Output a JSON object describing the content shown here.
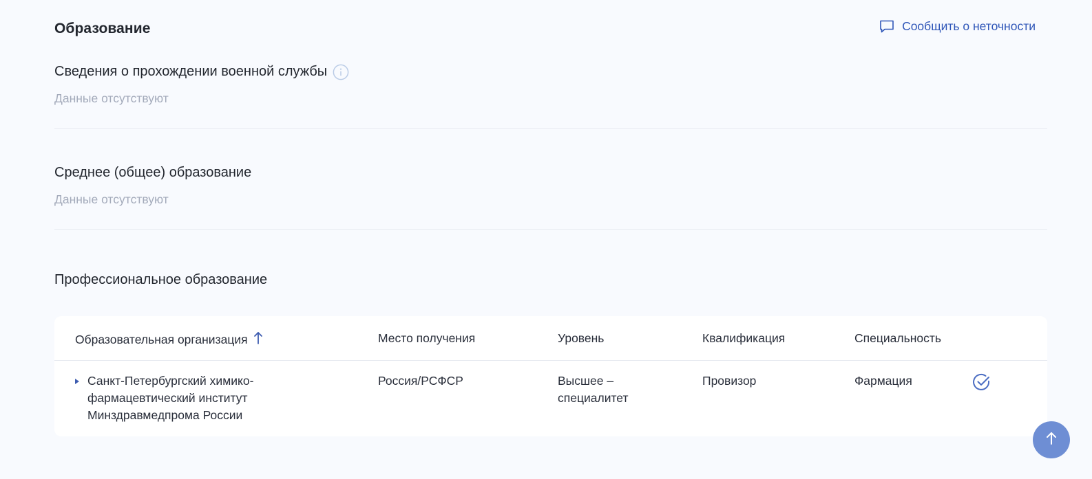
{
  "header": {
    "title": "Образование",
    "report_link": "Сообщить о неточности",
    "report_icon": "chat-bubble-icon"
  },
  "military": {
    "title": "Сведения о прохождении военной службы",
    "info_icon": "info-icon",
    "empty": "Данные отсутствуют"
  },
  "secondary": {
    "title": "Среднее (общее) образование",
    "empty": "Данные отсутствуют"
  },
  "professional": {
    "title": "Профессиональное образование",
    "columns": [
      "Образовательная организация",
      "Место получения",
      "Уровень",
      "Квалификация",
      "Специальность"
    ],
    "sort_icon": "arrow-up-icon",
    "rows": [
      {
        "organization": "Санкт-Петербургский химико-фармацевтический институт Минздравмедпрома России",
        "place": "Россия/РСФСР",
        "level": "Высшее – специалитет",
        "qualification": "Провизор",
        "specialty": "Фармация",
        "verified_icon": "check-circle-icon"
      }
    ]
  },
  "scroll_top_icon": "arrow-up-icon",
  "colors": {
    "background": "#f8fafe",
    "accent": "#2f56b8",
    "muted": "#a4abbb",
    "scroll_button": "#6e8ed4"
  }
}
